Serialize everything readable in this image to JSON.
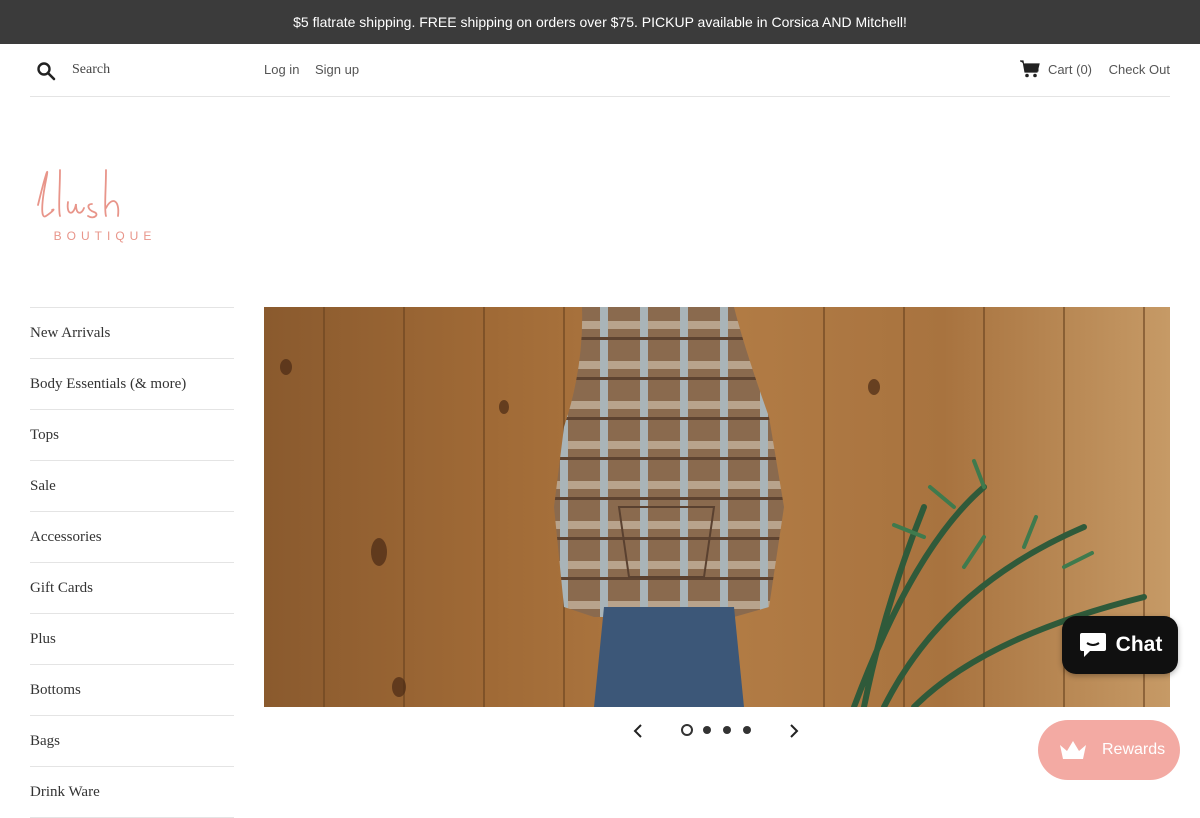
{
  "announcement": "$5 flatrate shipping. FREE shipping on orders over $75. PICKUP available in Corsica AND Mitchell!",
  "header": {
    "search_placeholder": "Search",
    "login_label": "Log in",
    "signup_label": "Sign up",
    "cart_label": "Cart (0)",
    "checkout_label": "Check Out"
  },
  "sidebar": {
    "items": [
      {
        "label": "New Arrivals"
      },
      {
        "label": "Body Essentials (& more)"
      },
      {
        "label": "Tops"
      },
      {
        "label": "Sale"
      },
      {
        "label": "Accessories"
      },
      {
        "label": "Gift Cards"
      },
      {
        "label": "Plus"
      },
      {
        "label": "Bottoms"
      },
      {
        "label": "Bags"
      },
      {
        "label": "Drink Ware"
      }
    ]
  },
  "slider": {
    "slide_count": 4,
    "active_slide": 1
  },
  "widgets": {
    "chat_label": "Chat",
    "rewards_label": "Rewards"
  },
  "colors": {
    "announcement_bg": "#3b3b3b",
    "logo_pink": "#e8958a",
    "rewards_pink": "#f3aaa3"
  },
  "icons": [
    "search-icon",
    "cart-icon",
    "chevron-left-icon",
    "chevron-right-icon",
    "chat-bubble-icon",
    "crown-icon"
  ]
}
